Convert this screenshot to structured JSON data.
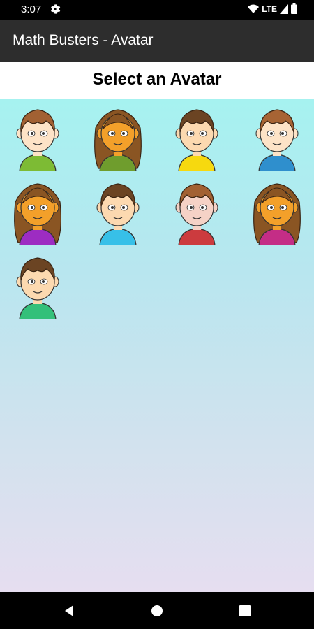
{
  "status_bar": {
    "time": "3:07",
    "network": "LTE",
    "icons": [
      "settings-gear-icon",
      "wifi-icon",
      "signal-icon",
      "battery-icon"
    ]
  },
  "app_bar": {
    "title": "Math Busters - Avatar"
  },
  "page": {
    "heading": "Select an Avatar"
  },
  "avatars": [
    {
      "name": "avatar-1",
      "skin": "#fde3c7",
      "hair": "#a26133",
      "shirt": "#7dbb34",
      "long_hair": false
    },
    {
      "name": "avatar-2",
      "skin": "#f3a02a",
      "hair": "#8a5523",
      "shirt": "#6f9d2d",
      "long_hair": true
    },
    {
      "name": "avatar-3",
      "skin": "#fcd9b0",
      "hair": "#6b4423",
      "shirt": "#f6d90f",
      "long_hair": false
    },
    {
      "name": "avatar-4",
      "skin": "#fde3c7",
      "hair": "#a76434",
      "shirt": "#2f8fcd",
      "long_hair": false
    },
    {
      "name": "avatar-5",
      "skin": "#f3a02a",
      "hair": "#8a5523",
      "shirt": "#9d2cc2",
      "long_hair": true
    },
    {
      "name": "avatar-6",
      "skin": "#fcd9b0",
      "hair": "#6b4423",
      "shirt": "#37c0e8",
      "long_hair": false
    },
    {
      "name": "avatar-7",
      "skin": "#f5d2c6",
      "hair": "#a26133",
      "shirt": "#cc3b3e",
      "long_hair": false
    },
    {
      "name": "avatar-8",
      "skin": "#f3a02a",
      "hair": "#8a5523",
      "shirt": "#c42d86",
      "long_hair": true
    },
    {
      "name": "avatar-9",
      "skin": "#fcd9b0",
      "hair": "#6b4423",
      "shirt": "#33c07a",
      "long_hair": false
    }
  ],
  "nav_bar": {
    "buttons": [
      "back-icon",
      "home-icon",
      "recents-icon"
    ]
  }
}
